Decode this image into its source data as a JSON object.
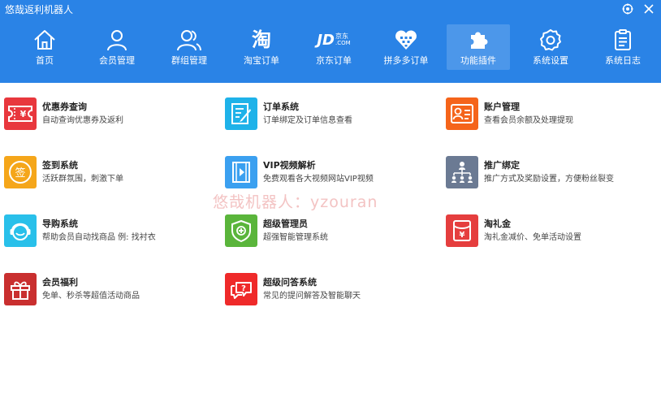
{
  "window": {
    "title": "悠哉返利机器人",
    "buttons": [
      "settings-icon",
      "close-icon"
    ]
  },
  "colors": {
    "header": "#2a83e6",
    "coupon": "#e8373d",
    "order": "#1eb2e9",
    "account": "#f5641a",
    "signin": "#f5a61a",
    "vip": "#3ba0f0",
    "promo": "#6b7a93",
    "guide": "#29c0ea",
    "admin": "#5ab53b",
    "taolijin": "#e53e3e",
    "welfare": "#c92f2f",
    "qa": "#ef2a2a"
  },
  "nav": [
    {
      "label": "首页",
      "icon": "home-icon"
    },
    {
      "label": "会员管理",
      "icon": "user-icon"
    },
    {
      "label": "群组管理",
      "icon": "group-icon"
    },
    {
      "label": "淘宝订单",
      "icon": "taobao-icon",
      "glyph": "淘"
    },
    {
      "label": "京东订单",
      "icon": "jd-icon",
      "glyph": "JD",
      "glyph_sub": "京东",
      "glyph_sub2": ".COM"
    },
    {
      "label": "拼多多订单",
      "icon": "pinduoduo-icon"
    },
    {
      "label": "功能插件",
      "icon": "puzzle-icon",
      "active": true
    },
    {
      "label": "系统设置",
      "icon": "gear-icon"
    },
    {
      "label": "系统日志",
      "icon": "log-icon"
    }
  ],
  "features": [
    {
      "title": "优惠券查询",
      "desc": "自动查询优惠券及返利",
      "icon": "coupon-icon",
      "glyph": "¥"
    },
    {
      "title": "订单系统",
      "desc": "订单绑定及订单信息查看",
      "icon": "order-icon"
    },
    {
      "title": "账户管理",
      "desc": "查看会员余额及处理提现",
      "icon": "account-icon"
    },
    {
      "title": "签到系统",
      "desc": "活跃群氛围，刺激下单",
      "icon": "signin-icon",
      "glyph": "签"
    },
    {
      "title": "VIP视频解析",
      "desc": "免费观看各大视频网站VIP视频",
      "icon": "video-icon"
    },
    {
      "title": "推广绑定",
      "desc": "推广方式及奖励设置，方便粉丝裂变",
      "icon": "promotion-icon"
    },
    {
      "title": "导购系统",
      "desc": "帮助会员自动找商品 例: 找衬衣",
      "icon": "guide-icon"
    },
    {
      "title": "超级管理员",
      "desc": "超强智能管理系统",
      "icon": "admin-shield-icon"
    },
    {
      "title": "淘礼金",
      "desc": "淘礼金减价、免单活动设置",
      "icon": "taolijin-icon",
      "glyph": "¥"
    },
    {
      "title": "会员福利",
      "desc": "免单、秒杀等超值活动商品",
      "icon": "gift-icon"
    },
    {
      "title": "超级问答系统",
      "desc": "常见的提问解答及智能聊天",
      "icon": "qa-icon",
      "glyph": "?"
    }
  ],
  "watermark": "悠哉机器人：yzouran"
}
